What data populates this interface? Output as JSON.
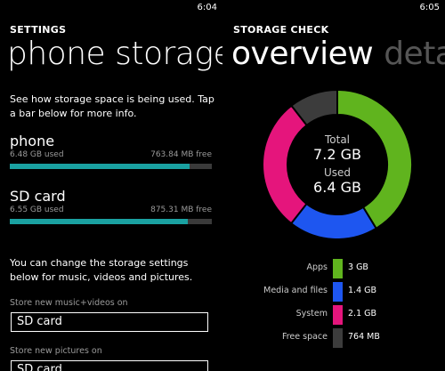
{
  "left_screen": {
    "clock": "6:04",
    "app_title": "SETTINGS",
    "page_title": "phone storage",
    "intro": "See how storage space is being used. Tap a bar below for more info.",
    "storage": [
      {
        "name": "phone",
        "used": "6.48 GB used",
        "free": "763.84 MB free",
        "fill_fraction": 0.89
      },
      {
        "name": "SD card",
        "used": "6.55 GB used",
        "free": "875.31 MB free",
        "fill_fraction": 0.88
      }
    ],
    "settings_intro": "You can change the storage settings below for music, videos and pictures.",
    "music_label": "Store new music+videos on",
    "music_value": "SD card",
    "pictures_label": "Store new pictures on",
    "pictures_value": "SD card"
  },
  "right_screen": {
    "clock": "6:05",
    "app_title": "STORAGE CHECK",
    "pivot_active": "overview",
    "pivot_next": "details",
    "center": {
      "total_label": "Total",
      "total_value": "7.2 GB",
      "used_label": "Used",
      "used_value": "6.4 GB"
    },
    "legend": [
      {
        "label": "Apps",
        "value": "3 GB",
        "gb": 3.0,
        "color": "#60b41e"
      },
      {
        "label": "Media and files",
        "value": "1.4 GB",
        "gb": 1.4,
        "color": "#1e56f0"
      },
      {
        "label": "System",
        "value": "2.1 GB",
        "gb": 2.1,
        "color": "#e5157c"
      },
      {
        "label": "Free space",
        "value": "764 MB",
        "gb": 0.764,
        "color": "#3c3c3c"
      }
    ]
  },
  "colors": {
    "accent_bar": "#1aa1a1",
    "bar_track": "#3a3a3a",
    "background": "#000000"
  }
}
